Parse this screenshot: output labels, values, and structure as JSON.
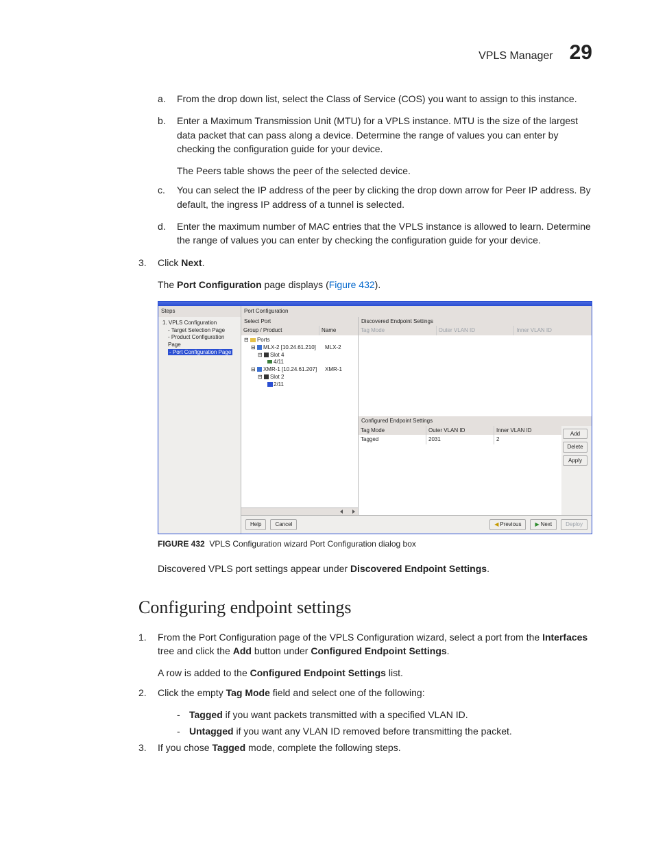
{
  "header": {
    "title": "VPLS Manager",
    "page_number": "29"
  },
  "steps": {
    "a": "From the drop down list, select the Class of Service (COS) you want to assign to this instance.",
    "b": "Enter a Maximum Transmission Unit (MTU) for a VPLS instance. MTU is the size of the largest data packet that can pass along a device. Determine the range of values you can enter by checking the configuration guide for your device.",
    "b_after": "The Peers table shows the peer of the selected device.",
    "c": "You can select the IP address of the peer by clicking the drop down arrow for Peer IP address. By default, the ingress IP address of a tunnel is selected.",
    "d": "Enter the maximum number of MAC entries that the VPLS instance is allowed to learn. Determine the range of values you can enter by checking the configuration guide for your device."
  },
  "step3": {
    "prefix": "Click ",
    "bold": "Next",
    "suffix": ".",
    "line2_a": "The ",
    "line2_b_bold": "Port Configuration",
    "line2_c": " page displays (",
    "line2_link": "Figure 432",
    "line2_d": ")."
  },
  "figure": {
    "steps_header": "Steps",
    "steps_tree": {
      "root": "1. VPLS Configuration",
      "a": "- Target Selection Page",
      "b": "- Product Configuration Page",
      "c": "- Port Configuration Page"
    },
    "main_header": "Port Configuration",
    "select_port": "Select Port",
    "col_group": "Group / Product",
    "col_name": "Name",
    "tree": {
      "ports": "Ports",
      "mlx": "MLX-2 [10.24.61.210]",
      "mlx_name": "MLX-2",
      "slot4": "Slot 4",
      "p411": "4/11",
      "xmr": "XMR-1 [10.24.61.207]",
      "xmr_name": "XMR-1",
      "slot2": "Slot 2",
      "p211": "2/11"
    },
    "disc_hdr": "Discovered Endpoint Settings",
    "conf_hdr": "Configured Endpoint Settings",
    "cols": {
      "tag": "Tag Mode",
      "outer": "Outer VLAN ID",
      "inner": "Inner VLAN ID"
    },
    "conf_row": {
      "tag": "Tagged",
      "outer": "2031",
      "inner": "2"
    },
    "btn_add": "Add",
    "btn_delete": "Delete",
    "btn_apply": "Apply",
    "btn_help": "Help",
    "btn_cancel": "Cancel",
    "btn_prev": "Previous",
    "btn_next": "Next",
    "btn_deploy": "Deploy",
    "caption_label": "FIGURE 432",
    "caption_text": "VPLS Configuration wizard Port Configuration dialog box"
  },
  "after_figure": {
    "a": "Discovered VPLS port settings appear under ",
    "b_bold": "Discovered Endpoint Settings",
    "c": "."
  },
  "section_title": "Configuring endpoint settings",
  "cfg": {
    "s1_a": "From the Port Configuration page of the VPLS Configuration wizard, select a port from the ",
    "s1_b_bold": "Interfaces",
    "s1_c": " tree and click the ",
    "s1_d_bold": "Add",
    "s1_e": " button under ",
    "s1_f_bold": "Configured Endpoint Settings",
    "s1_g": ".",
    "s1_after_a": "A row is added to the ",
    "s1_after_b_bold": "Configured Endpoint Settings",
    "s1_after_c": " list.",
    "s2_a": "Click the empty ",
    "s2_b_bold": "Tag Mode",
    "s2_c": " field and select one of the following:",
    "s2_opt1_bold": "Tagged",
    "s2_opt1_rest": " if you want packets transmitted with a specified VLAN ID.",
    "s2_opt2_bold": "Untagged",
    "s2_opt2_rest": " if you want any VLAN ID removed before transmitting the packet.",
    "s3_a": "If you chose ",
    "s3_b_bold": "Tagged",
    "s3_c": " mode, complete the following steps."
  }
}
